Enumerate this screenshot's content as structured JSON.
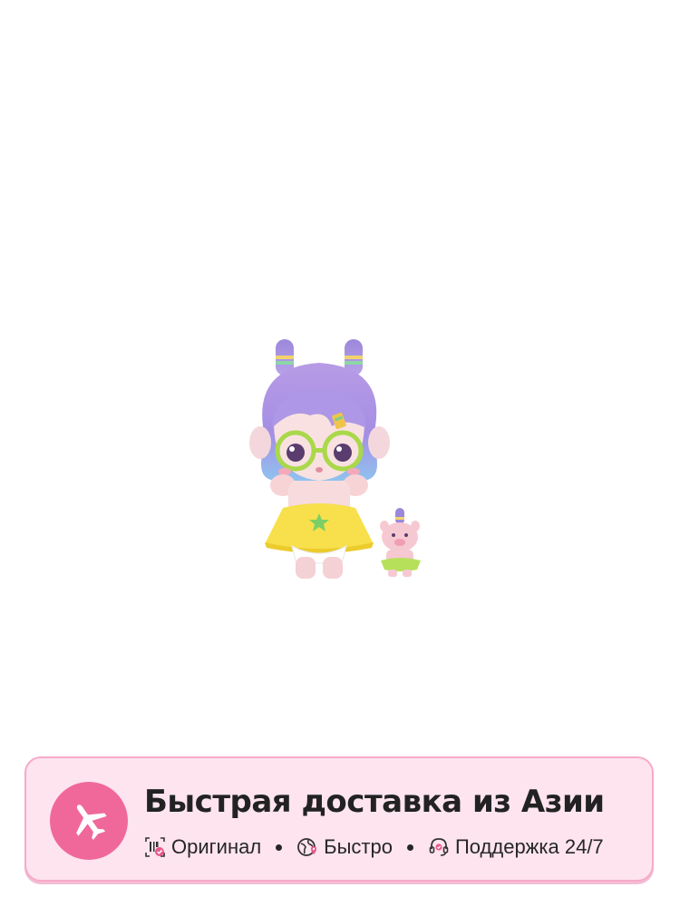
{
  "product": {
    "image_description_icon": "toy-figure-image"
  },
  "banner": {
    "title": "Быстрая доставка из Азии",
    "icon": "airplane-icon",
    "accent_color": "#f0689a",
    "background_color": "#fde4ef",
    "features": [
      {
        "label": "Оригинал",
        "icon": "original-check-icon"
      },
      {
        "label": "Быстро",
        "icon": "globe-icon"
      },
      {
        "label": "Поддержка 24/7",
        "icon": "headset-icon"
      }
    ]
  }
}
